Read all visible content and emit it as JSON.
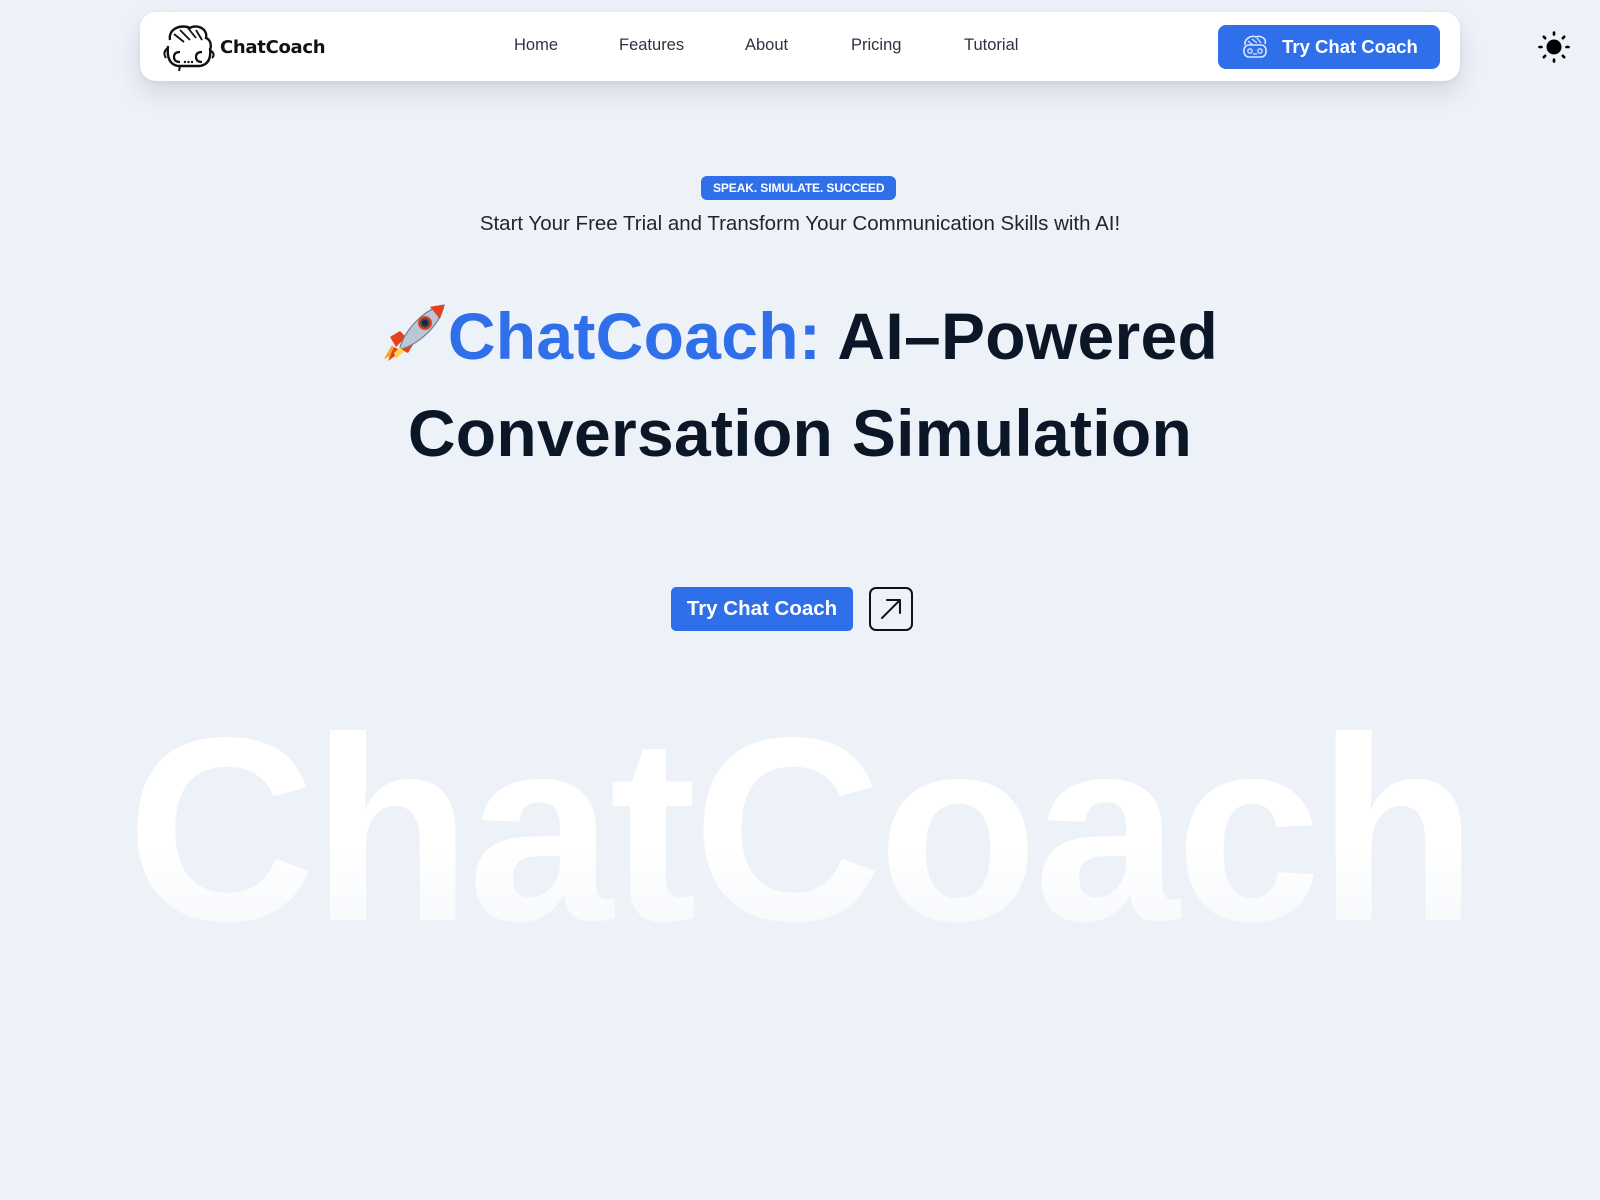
{
  "brand": {
    "name": "ChatCoach"
  },
  "nav": {
    "links": [
      "Home",
      "Features",
      "About",
      "Pricing",
      "Tutorial"
    ],
    "cta_label": "Try Chat Coach",
    "theme_toggle": "sun-icon"
  },
  "hero": {
    "badge": "SPEAK. SIMULATE. SUCCEED",
    "subtitle": "Start Your Free Trial and Transform Your Communication Skills with AI!",
    "title_accent": "ChatCoach:",
    "title_rest_line1": "AI–Powered",
    "title_line2": "Conversation Simulation",
    "cta_label": "Try Chat Coach",
    "watermark": "ChatCoach"
  },
  "colors": {
    "accent": "#2f6fea",
    "background": "#edf1f8",
    "text": "#0b1626"
  }
}
